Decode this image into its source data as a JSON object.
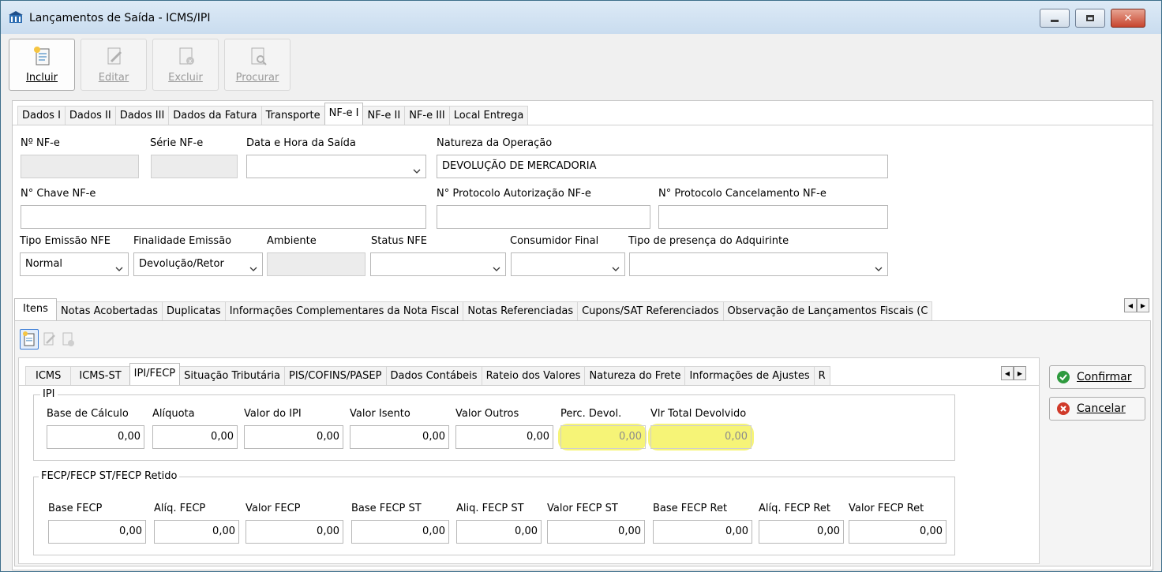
{
  "window": {
    "title": "Lançamentos de Saída - ICMS/IPI"
  },
  "toolbar": {
    "buttons": [
      {
        "label": "Incluir",
        "icon": "new-document-icon",
        "enabled": true
      },
      {
        "label": "Editar",
        "icon": "edit-document-icon",
        "enabled": false
      },
      {
        "label": "Excluir",
        "icon": "delete-document-icon",
        "enabled": false
      },
      {
        "label": "Procurar",
        "icon": "search-document-icon",
        "enabled": false
      }
    ]
  },
  "main_tabs": [
    "Dados I",
    "Dados II",
    "Dados III",
    "Dados da Fatura",
    "Transporte",
    "NF-e I",
    "NF-e II",
    "NF-e III",
    "Local Entrega"
  ],
  "main_tabs_active": "NF-e I",
  "nfe": {
    "numero_label": "Nº NF-e",
    "numero_value": "",
    "serie_label": "Série NF-e",
    "serie_value": "",
    "data_hora_label": "Data e Hora da Saída",
    "data_hora_value": "",
    "natureza_label": "Natureza da Operação",
    "natureza_value": "DEVOLUÇÃO DE MERCADORIA",
    "chave_label": "N° Chave NF-e",
    "chave_value": "",
    "protocolo_aut_label": "N° Protocolo Autorização NF-e",
    "protocolo_aut_value": "",
    "protocolo_canc_label": "N° Protocolo Cancelamento NF-e",
    "protocolo_canc_value": "",
    "tipo_emissao_label": "Tipo Emissão NFE",
    "tipo_emissao_value": "Normal",
    "finalidade_label": "Finalidade Emissão",
    "finalidade_value": "Devolução/Retor",
    "ambiente_label": "Ambiente",
    "ambiente_value": "",
    "status_label": "Status NFE",
    "status_value": "",
    "consumidor_label": "Consumidor Final",
    "consumidor_value": "",
    "presenca_label": "Tipo de presença do Adquirinte",
    "presenca_value": ""
  },
  "sub_tabs": [
    "Itens",
    "Notas Acobertadas",
    "Duplicatas",
    "Informações Complementares da Nota Fiscal",
    "Notas Referenciadas",
    "Cupons/SAT Referenciados",
    "Observação de Lançamentos Fiscais (C"
  ],
  "sub_tabs_active": "Itens",
  "item_tabs": [
    "ICMS",
    "ICMS-ST",
    "IPI/FECP",
    "Situação Tributária",
    "PIS/COFINS/PASEP",
    "Dados Contábeis",
    "Rateio dos Valores",
    "Natureza do Frete",
    "Informações de Ajustes",
    "R"
  ],
  "item_tabs_active": "IPI/FECP",
  "ipi": {
    "group_title": "IPI",
    "fields": [
      {
        "label": "Base de Cálculo",
        "value": "0,00"
      },
      {
        "label": "Alíquota",
        "value": "0,00"
      },
      {
        "label": "Valor do IPI",
        "value": "0,00"
      },
      {
        "label": "Valor Isento",
        "value": "0,00"
      },
      {
        "label": "Valor Outros",
        "value": "0,00"
      },
      {
        "label": "Perc. Devol.",
        "value": "0,00"
      },
      {
        "label": "Vlr Total Devolvido",
        "value": "0,00"
      }
    ]
  },
  "fecp": {
    "group_title": "FECP/FECP ST/FECP Retido",
    "fields": [
      {
        "label": "Base FECP",
        "value": "0,00"
      },
      {
        "label": "Alíq. FECP",
        "value": "0,00"
      },
      {
        "label": "Valor FECP",
        "value": "0,00"
      },
      {
        "label": "Base FECP ST",
        "value": "0,00"
      },
      {
        "label": "Aliq. FECP ST",
        "value": "0,00"
      },
      {
        "label": "Valor FECP ST",
        "value": "0,00"
      },
      {
        "label": "Base FECP Ret",
        "value": "0,00"
      },
      {
        "label": "Alíq. FECP Ret",
        "value": "0,00"
      },
      {
        "label": "Valor FECP Ret",
        "value": "0,00"
      }
    ]
  },
  "actions": {
    "confirm_label": "Confirmar",
    "cancel_label": "Cancelar"
  },
  "colors": {
    "highlight": "#f3f04a",
    "confirm_green": "#2e9a3e",
    "cancel_red": "#d03a2a"
  }
}
